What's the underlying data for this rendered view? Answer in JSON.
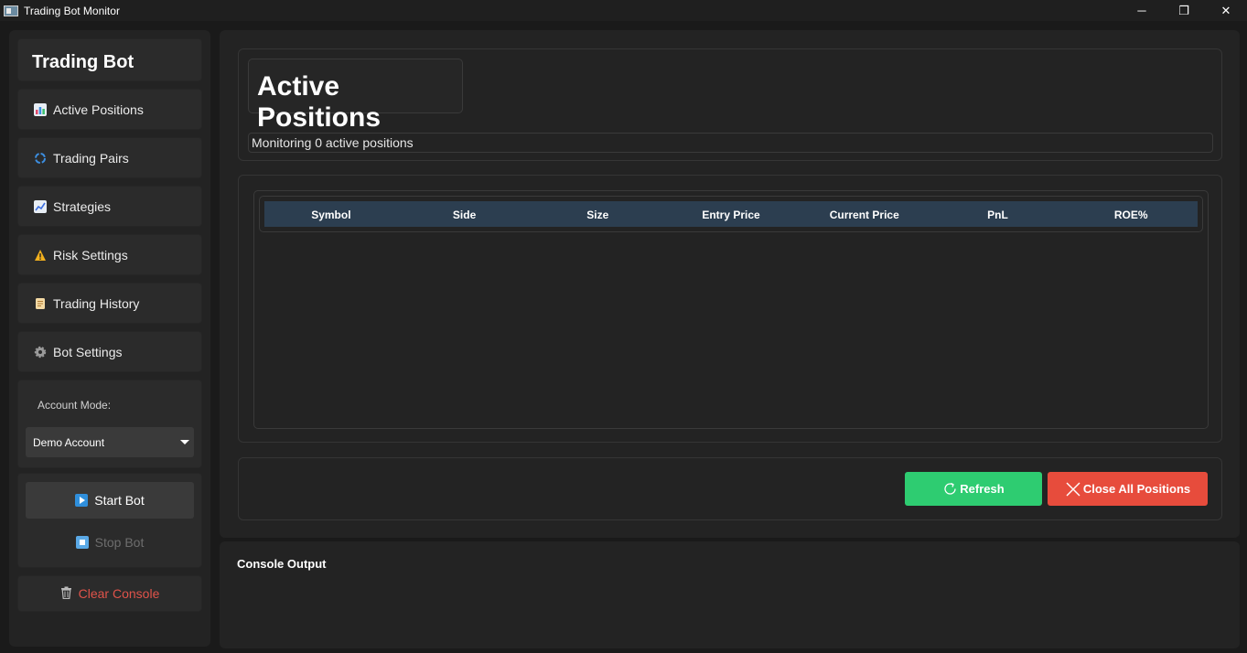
{
  "window": {
    "title": "Trading Bot Monitor",
    "controls": {
      "minimize": "─",
      "restore": "❐",
      "close": "✕"
    }
  },
  "sidebar": {
    "title": "Trading Bot",
    "items": [
      {
        "label": "Active Positions",
        "icon": "bar-chart-icon"
      },
      {
        "label": "Trading Pairs",
        "icon": "refresh-cycle-icon"
      },
      {
        "label": "Strategies",
        "icon": "line-chart-icon"
      },
      {
        "label": "Risk Settings",
        "icon": "warning-icon"
      },
      {
        "label": "Trading History",
        "icon": "scroll-icon"
      },
      {
        "label": "Bot Settings",
        "icon": "gear-icon"
      }
    ],
    "account_mode_label": "Account Mode:",
    "account_mode_value": "Demo Account",
    "start_bot_label": "Start Bot",
    "stop_bot_label": "Stop Bot",
    "clear_console_label": "Clear Console"
  },
  "main": {
    "page_title": "Active Positions",
    "status": "Monitoring 0 active positions",
    "table": {
      "columns": [
        "Symbol",
        "Side",
        "Size",
        "Entry Price",
        "Current Price",
        "PnL",
        "ROE%"
      ],
      "rows": []
    },
    "refresh_label": "Refresh",
    "close_all_label": "Close All Positions"
  },
  "console": {
    "title": "Console Output"
  },
  "colors": {
    "refresh": "#2ecc71",
    "close_all": "#e74c3c",
    "table_header": "#2c3e50",
    "clear_console_text": "#e0534a"
  }
}
